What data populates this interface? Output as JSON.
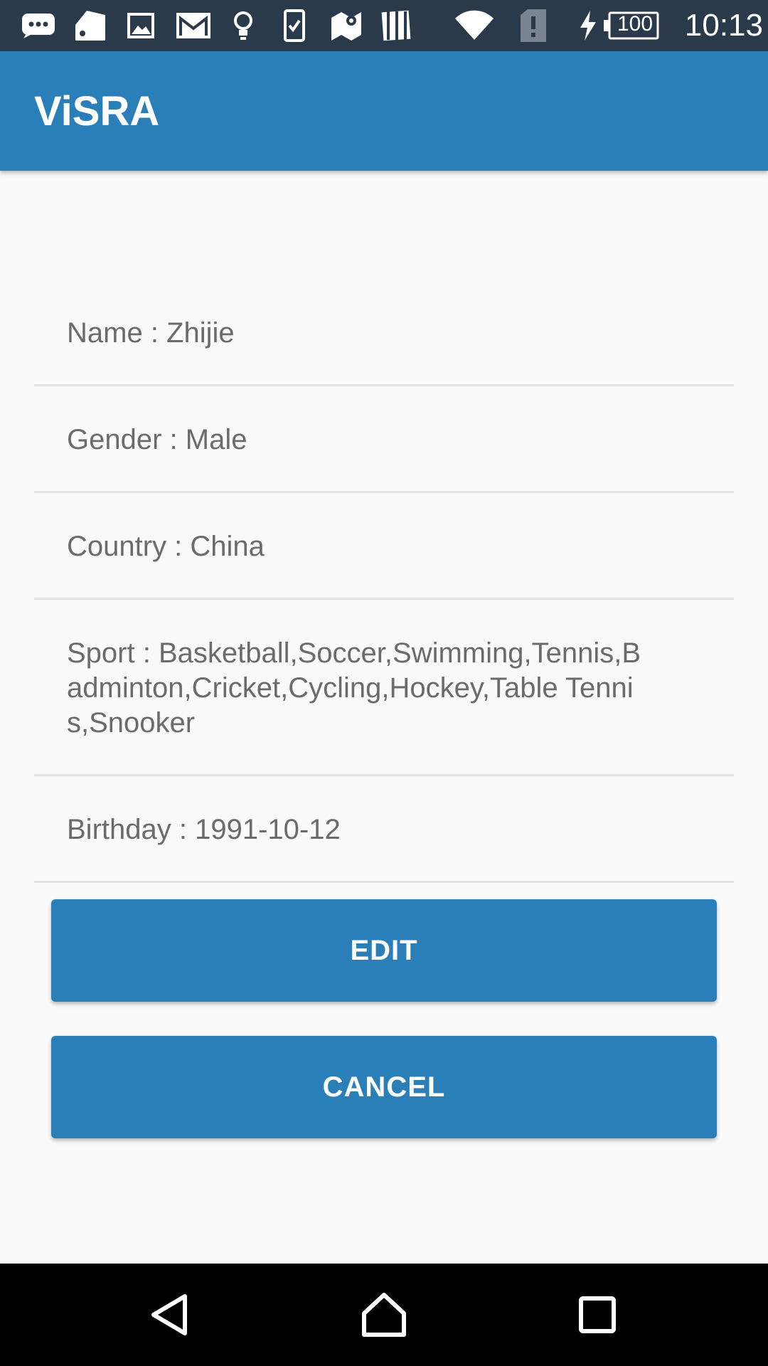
{
  "status_bar": {
    "icons": [
      "chat-bubble-icon",
      "tag-icon",
      "image-icon",
      "gmail-icon",
      "lightbulb-icon",
      "task-check-icon",
      "maps-icon",
      "film-icon",
      "wifi-icon",
      "sim-alert-icon",
      "charging-icon"
    ],
    "battery": "100",
    "time": "10:13"
  },
  "app_bar": {
    "title": "ViSRA",
    "color": "#2b7fb9"
  },
  "profile": {
    "name": "Name : Zhijie",
    "gender": "Gender : Male",
    "country": "Country : China",
    "sport": "Sport : Basketball,Soccer,Swimming,Tennis,Badminton,Cricket,Cycling,Hockey,Table Tennis,Snooker",
    "birthday": "Birthday : 1991-10-12"
  },
  "actions": {
    "edit_label": "EDIT",
    "cancel_label": "CANCEL"
  },
  "nav_bar": {
    "icons": [
      "back-icon",
      "home-icon",
      "recents-icon"
    ]
  }
}
